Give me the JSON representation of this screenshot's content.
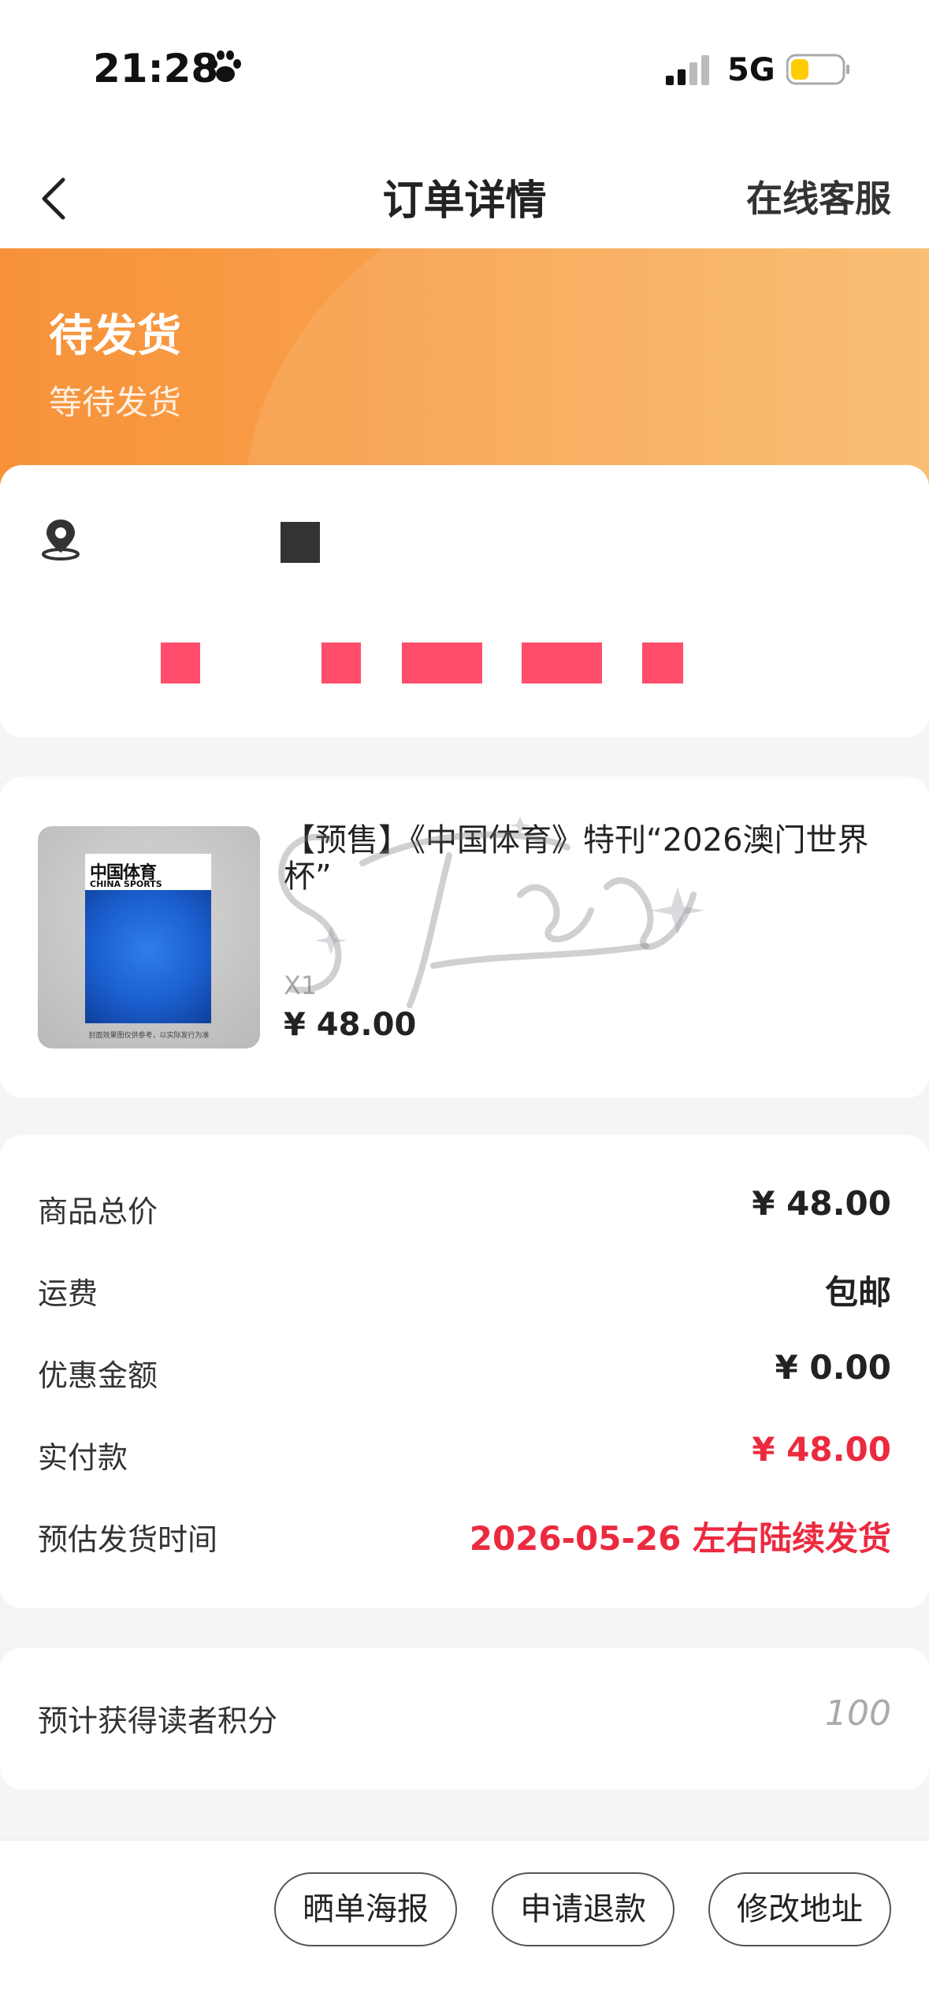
{
  "status_bar": {
    "time": "21:28",
    "network": "5G",
    "icons": [
      "paw-icon",
      "signal-icon",
      "battery-icon"
    ]
  },
  "nav": {
    "title": "订单详情",
    "right_action": "在线客服",
    "back_icon": "chevron-left-icon"
  },
  "status_header": {
    "title": "待发货",
    "subtitle": "等待发货",
    "colors": {
      "start": "#f7923a",
      "end": "#f9b865"
    }
  },
  "address": {
    "icon": "location-pin-icon",
    "redacted": true
  },
  "product": {
    "title": "【预售】《中国体育》特刊“2026澳门世界杯”",
    "quantity": "X1",
    "price": "¥ 48.00",
    "cover": {
      "title": "中国体育",
      "subtitle": "CHINA SPORTS",
      "note": "封面效果图仅供参考，以实际发行为准"
    }
  },
  "summary": {
    "rows": [
      {
        "label": "商品总价",
        "value": "¥ 48.00"
      },
      {
        "label": "运费",
        "value": "包邮"
      },
      {
        "label": "优惠金额",
        "value": "¥ 0.00"
      },
      {
        "label": "实付款",
        "value": "¥ 48.00"
      },
      {
        "label": "预估发货时间",
        "value": "2026-05-26 左右陆续发货"
      }
    ],
    "highlight_color": "#ec2a3f"
  },
  "points": {
    "label": "预计获得读者积分",
    "value": "100"
  },
  "actions": {
    "share_poster": "晒单海报",
    "refund": "申请退款",
    "change_address": "修改地址"
  }
}
